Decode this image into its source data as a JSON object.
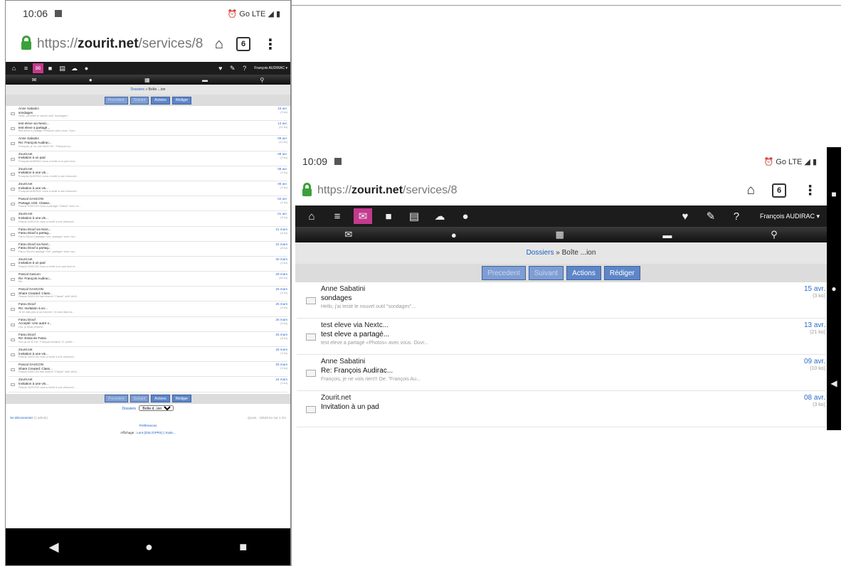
{
  "portrait": {
    "time": "10:06",
    "network": "⏰ Go LTE ◢ ▮",
    "url_scheme": "https://",
    "url_host": "zourit.net",
    "url_path": "/services/8",
    "tab_count": "6",
    "user": "François AUDIRAC ▾",
    "breadcrumb_link": "Dossiers",
    "breadcrumb_rest": " » Boîte ...ion",
    "btn_prev": "Precedent",
    "btn_next": "Suivant",
    "btn_actions": "Actions",
    "btn_compose": "Rédiger",
    "messages": [
      {
        "from": "Anne Sabatini",
        "subject": "sondages",
        "preview": "Hello, j'ai testé le nouvel outil \"sondages\"...",
        "date": "15 avr.",
        "size": "(3 ko)"
      },
      {
        "from": "test eleve via Nextc...",
        "subject": "test eleve a partagé...",
        "preview": "test eleve a partagé «Photos» avec vous. Ouvr...",
        "date": "13 avr.",
        "size": "(21 ko)"
      },
      {
        "from": "Anne Sabatini",
        "subject": "Re: François Audirac...",
        "preview": "François, je ne vois rien!!! De: \"François Au...",
        "date": "09 avr.",
        "size": "(10 ko)"
      },
      {
        "from": "Zourit.net",
        "subject": "Invitation à un pad",
        "preview": "François AUDIRAC vous a invité à un pad dont...",
        "date": "08 avr.",
        "size": "(3 ko)"
      },
      {
        "from": "Zourit.net",
        "subject": "Invitation à une vis...",
        "preview": "François AUDIRAC vous a invité à une visioconf...",
        "date": "08 avr.",
        "size": "(3 ko)"
      },
      {
        "from": "Zourit.net",
        "subject": "Invitation à une vis...",
        "preview": "François AUDIRAC vous a invité à une visioconf...",
        "date": "08 avr.",
        "size": "(3 ko)"
      },
      {
        "from": "Pascal GASCON",
        "subject": "Partage créé: Classe...",
        "preview": "Pascal GASCON vous a partagé \"Classe\" avec vo...",
        "date": "04 avr.",
        "size": "(4 ko)"
      },
      {
        "from": "Zourit.net",
        "subject": "Invitation à une vis...",
        "preview": "Pascal GASCON vous a invité à une visioconf...",
        "date": "01 avr.",
        "size": "(3 ko)"
      },
      {
        "from": "Fatou Diouf via Next...",
        "subject": "Fatou Diouf a partag...",
        "preview": "Fatou Diouf a partagé «Ver_partage» avec vou...",
        "date": "31 mars",
        "size": "(8 ko)"
      },
      {
        "from": "Fatou Diouf via Next...",
        "subject": "Fatou Diouf a partag...",
        "preview": "Fatou Diouf a partagé «Ver_partage» avec vou...",
        "date": "31 mars",
        "size": "(8 ko)"
      },
      {
        "from": "Zourit.net",
        "subject": "Invitation à un pad",
        "preview": "Pascal GASCON vous a invité à un pad dont le...",
        "date": "30 mars",
        "size": "(3 ko)"
      },
      {
        "from": "Pascal Gascon",
        "subject": "Re: François Audirac...",
        "preview": "Re:",
        "date": "29 mars",
        "size": "(48 ko)"
      },
      {
        "from": "Pascal GASCON",
        "subject": "Share Created: Class...",
        "preview": "Pascal GASCON has shared \"Classe\" with Verifi...",
        "date": "26 mars",
        "size": "(4 ko)"
      },
      {
        "from": "Fatou Diouf",
        "subject": "Re: Invitation à un...",
        "preview": "Je ne sais pas si ça marche ! Je suis dans la...",
        "date": "25 mars",
        "size": "(5 ko)"
      },
      {
        "from": "Fatou Diouf",
        "subject": "Accepté: Une autre v...",
        "preview": "Oui, je serai présent",
        "date": "25 mars",
        "size": "(3 ko)"
      },
      {
        "from": "Fatou Diouf",
        "subject": "Re: Essai de Fatou",
        "preview": "Oui ça va 😊 De: \"François Audirac\" À: public...",
        "date": "25 mars",
        "size": "(8 ko)"
      },
      {
        "from": "Zourit.net",
        "subject": "Invitation à une vis...",
        "preview": "Pascal GASCON vous a invité à une visioconf...",
        "date": "25 mars",
        "size": "(3 ko)"
      },
      {
        "from": "Pascal GASCON",
        "subject": "Share Created: Class...",
        "preview": "Pascal GASCON has shared \"Classe\" with Verifi...",
        "date": "25 mars",
        "size": "(4 ko)"
      },
      {
        "from": "Zourit.net",
        "subject": "Invitation à une vis...",
        "preview": "Pascal GASCON vous a invité à une visioconf...",
        "date": "24 mars",
        "size": "(3 ko)"
      }
    ],
    "folders_label": "Dossiers",
    "folder_select": "Boîte d...ion",
    "logout": "Se déconnecter",
    "logout_note": "(1 admin)",
    "quota": "Quota : 10528 ko sur 1 Go",
    "preferences": "Préférences",
    "display_label": "Affichage :",
    "display_value": "Lent (DSL/GPRS) | Suite...",
    "nav_back": "◀",
    "nav_home": "●",
    "nav_recent": "■"
  },
  "landscape": {
    "time": "10:09",
    "network": "⏰ Go LTE ◢ ▮",
    "url_scheme": "https://",
    "url_host": "zourit.net",
    "url_path": "/services/8",
    "tab_count": "6",
    "user": "François AUDIRAC ▾",
    "breadcrumb_link": "Dossiers",
    "breadcrumb_rest": " » Boîte ...ion",
    "btn_prev": "Precedent",
    "btn_next": "Suivant",
    "btn_actions": "Actions",
    "btn_compose": "Rédiger",
    "messages": [
      {
        "from": "Anne Sabatini",
        "subject": "sondages",
        "preview": "Hello, j'ai testé le nouvel outil \"sondages\"...",
        "date": "15 avr.",
        "size": "(3 ko)"
      },
      {
        "from": "test eleve via Nextc...",
        "subject": "test eleve a partagé...",
        "preview": "test eleve a partagé «Photos» avec vous. Ouvr...",
        "date": "13 avr.",
        "size": "(21 ko)"
      },
      {
        "from": "Anne Sabatini",
        "subject": "Re: François Audirac...",
        "preview": "François, je ne vois rien!!! De: \"François Au...",
        "date": "09 avr.",
        "size": "(10 ko)"
      },
      {
        "from": "Zourit.net",
        "subject": "Invitation à un pad",
        "preview": "",
        "date": "08 avr.",
        "size": "(3 ko)"
      }
    ],
    "nav_recent": "■",
    "nav_home": "●",
    "nav_back": "◀"
  }
}
